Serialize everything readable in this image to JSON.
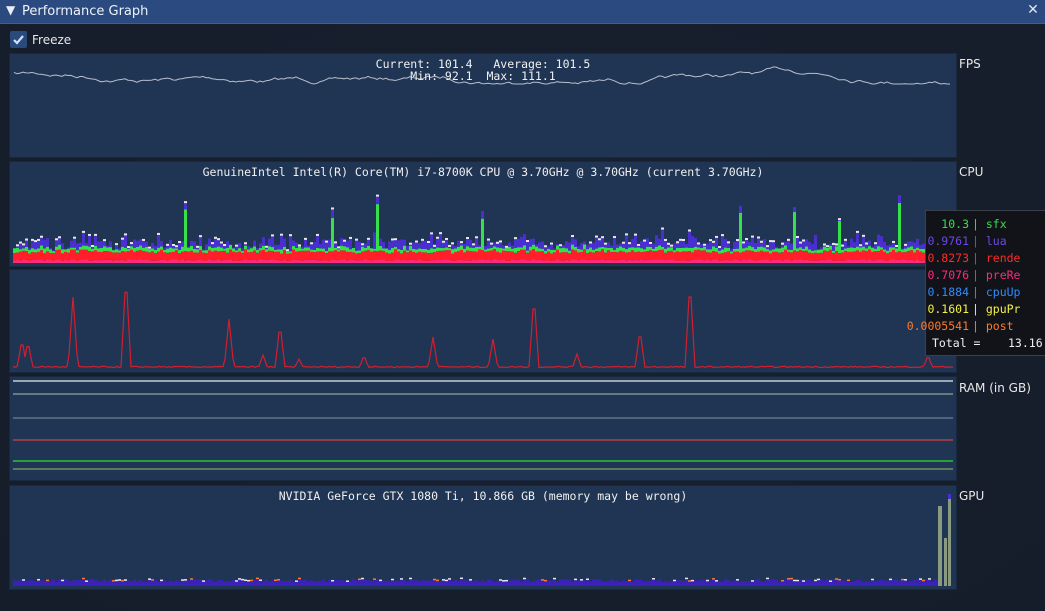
{
  "window": {
    "title": "Performance Graph",
    "collapse_icon": "triangle-down-icon",
    "close_icon": "close-icon"
  },
  "freeze": {
    "label": "Freeze",
    "checked": true
  },
  "fps": {
    "label": "FPS",
    "stats_line1": "Current: 101.4   Average: 101.5",
    "stats_line2": "Min: 92.1  Max: 111.1",
    "current": 101.4,
    "average": 101.5,
    "min": 92.1,
    "max": 111.1
  },
  "cpu": {
    "label": "CPU",
    "name": "GenuineIntel Intel(R) Core(TM) i7-8700K CPU @ 3.70GHz @ 3.70GHz (current 3.70GHz)"
  },
  "ram": {
    "label": "RAM (in GB)"
  },
  "gpu": {
    "label": "GPU",
    "name": "NVIDIA GeForce GTX 1080 Ti, 10.866 GB (memory may be wrong)"
  },
  "tooltip": {
    "rows": [
      {
        "value": "10.3",
        "name": "| sfx",
        "color": "#35e04a"
      },
      {
        "value": "0.9761",
        "name": "| lua",
        "color": "#6b48e8"
      },
      {
        "value": "0.8273",
        "name": "| rende",
        "color": "#ff2a2a"
      },
      {
        "value": "0.7076",
        "name": "| preRe",
        "color": "#ff2a7a"
      },
      {
        "value": "0.1884",
        "name": "| cpuUp",
        "color": "#2f8cff"
      },
      {
        "value": "0.1601",
        "name": "| gpuPr",
        "color": "#f2f24a"
      },
      {
        "value": "0.0005541",
        "name": "| post",
        "color": "#ff7a2a"
      }
    ],
    "total_label": "Total =",
    "total_value": "13.16"
  },
  "colors": {
    "panel": "#1f3553",
    "title_bar": "#2a4a80",
    "fps_line": "#b9c0cc",
    "cpu_spike": "#d21f2f"
  }
}
